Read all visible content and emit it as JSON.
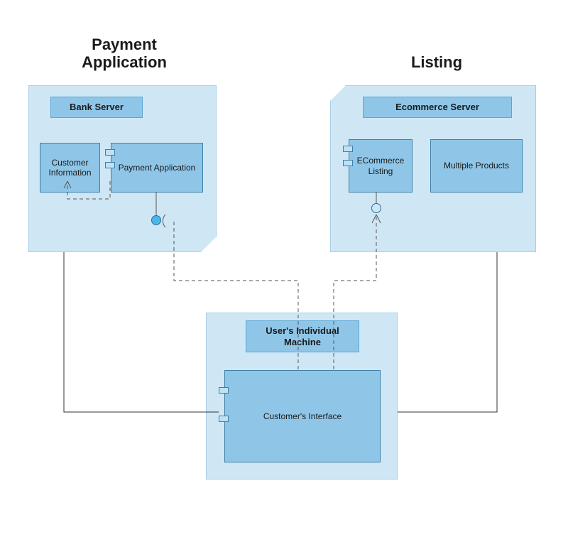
{
  "diagram": {
    "type": "UML Deployment Diagram",
    "titles": {
      "payment": "Payment\nApplication",
      "listing": "Listing"
    },
    "nodes": {
      "bank_node": {
        "header": "Bank Server",
        "components": {
          "customer_info": "Customer\nInformation",
          "payment_app": "Payment Application"
        }
      },
      "ecommerce_node": {
        "header": "Ecommerce Server",
        "components": {
          "ecommerce_listing": "ECommerce\nListing",
          "multiple_products": "Multiple Products"
        }
      },
      "user_node": {
        "header": "User's Individual\nMachine",
        "components": {
          "customer_interface": "Customer's Interface"
        }
      }
    },
    "colors": {
      "node_fill": "#cfe7f5",
      "box_fill": "#8fc6e8",
      "border": "#5aa7d6",
      "circle": "#49b8e8"
    },
    "connections": [
      {
        "from": "payment_app",
        "to": "customer_info",
        "style": "dashed",
        "arrow": "open",
        "kind": "dependency"
      },
      {
        "from": "customer_interface",
        "to": "payment_app_interface_circle",
        "style": "dashed",
        "arrow": "open",
        "kind": "required-interface"
      },
      {
        "from": "customer_interface",
        "to": "ecommerce_listing",
        "style": "dashed",
        "arrow": "open",
        "kind": "dependency"
      },
      {
        "from": "bank_node",
        "to": "user_node",
        "style": "solid",
        "arrow": "none",
        "kind": "association"
      },
      {
        "from": "ecommerce_node",
        "to": "user_node",
        "style": "solid",
        "arrow": "none",
        "kind": "association"
      }
    ]
  }
}
